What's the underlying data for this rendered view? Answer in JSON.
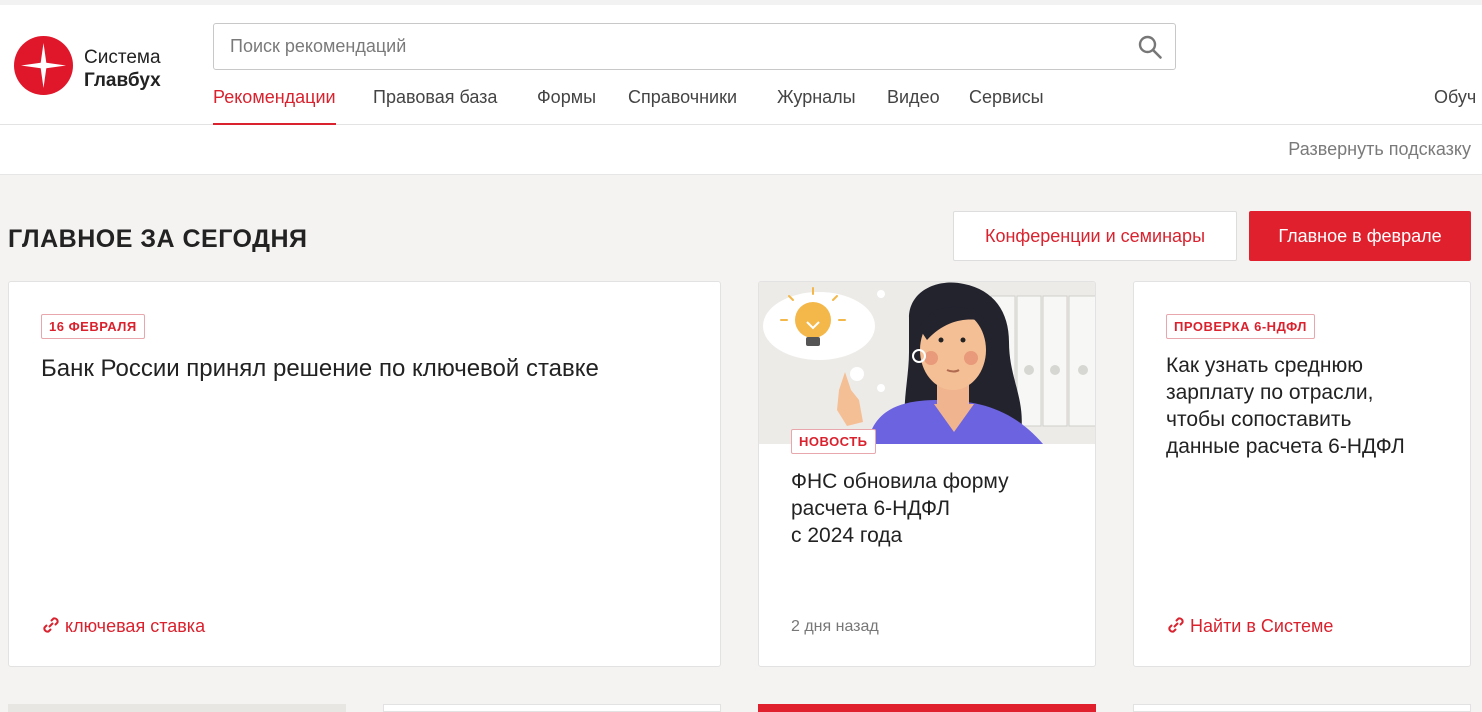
{
  "brand": {
    "line1": "Система",
    "line2": "Главбух"
  },
  "search": {
    "placeholder": "Поиск рекомендаций",
    "value": ""
  },
  "nav": {
    "items": [
      {
        "label": "Рекомендации",
        "active": true
      },
      {
        "label": "Правовая база"
      },
      {
        "label": "Формы"
      },
      {
        "label": "Справочники"
      },
      {
        "label": "Журналы"
      },
      {
        "label": "Видео"
      },
      {
        "label": "Сервисы"
      }
    ],
    "more_label": "Обуч"
  },
  "hint": {
    "expand_label": "Развернуть подсказку"
  },
  "main": {
    "section_title": "ГЛАВНОЕ ЗА СЕГОДНЯ",
    "conferences_button": "Конференции и семинары",
    "feature_button": "Главное в феврале"
  },
  "cards": [
    {
      "tag": "16 ФЕВРАЛЯ",
      "title": "Банк России принял решение по ключевой ставке",
      "link": "ключевая ставка"
    },
    {
      "tag": "НОВОСТЬ",
      "title_lines": [
        "ФНС обновила форму",
        "расчета 6-НДФЛ",
        "с 2024 года"
      ],
      "meta": "2 дня назад"
    },
    {
      "tag": "ПРОВЕРКА 6-НДФЛ",
      "title_lines": [
        "Как узнать среднюю",
        "зарплату по отрасли,",
        "чтобы сопоставить",
        "данные расчета 6-НДФЛ"
      ],
      "link": "Найти в Системе"
    }
  ],
  "colors": {
    "accent": "#e0202d",
    "background": "#f4f3f1"
  }
}
